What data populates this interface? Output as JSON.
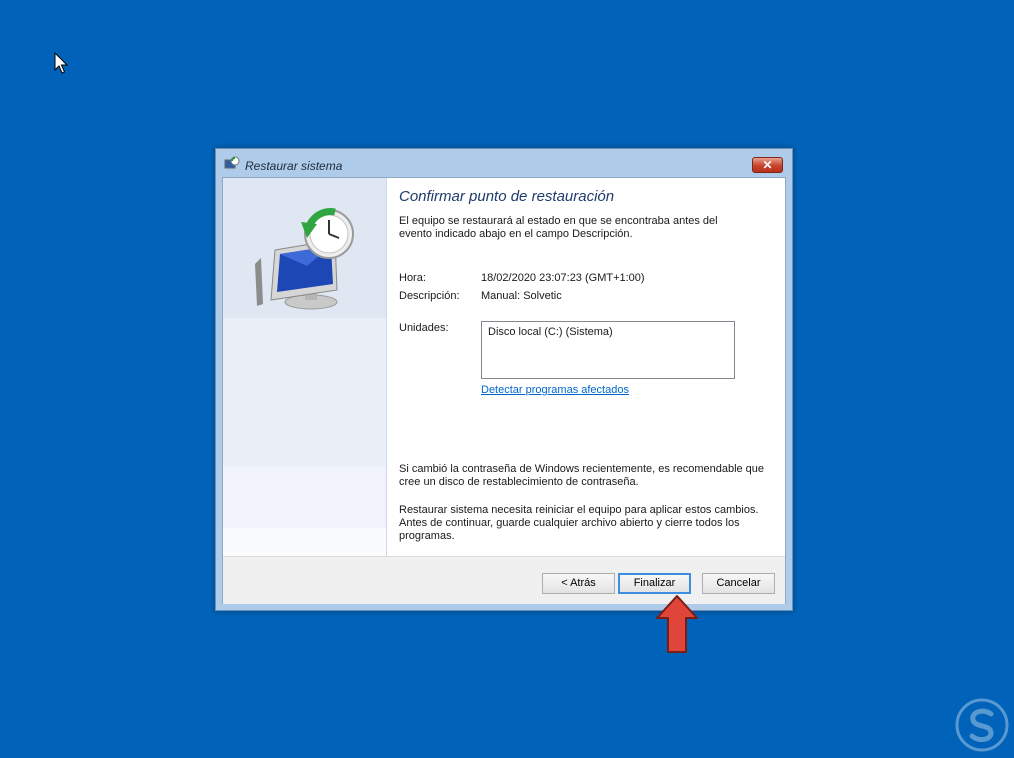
{
  "window": {
    "title": "Restaurar sistema",
    "close_label": "✕"
  },
  "page": {
    "heading": "Confirmar punto de restauración",
    "intro": "El equipo se restaurará al estado en que se encontraba antes del evento indicado abajo en el campo Descripción.",
    "time_label": "Hora:",
    "time_value": "18/02/2020 23:07:23 (GMT+1:00)",
    "description_label": "Descripción:",
    "description_value": "Manual: Solvetic",
    "drives_label": "Unidades:",
    "drives_value": "Disco local (C:) (Sistema)",
    "detect_link": "Detectar programas afectados",
    "password_note": "Si cambió la contraseña de Windows recientemente, es recomendable que cree un disco de restablecimiento de contraseña.",
    "restart_note": "Restaurar sistema necesita reiniciar el equipo para aplicar estos cambios. Antes de continuar, guarde cualquier archivo abierto y cierre todos los programas."
  },
  "buttons": {
    "back": "< Atrás",
    "finish": "Finalizar",
    "cancel": "Cancelar"
  },
  "icons": {
    "cursor": "mouse-pointer-icon",
    "title": "system-restore-icon",
    "sidebar": "restore-computer-clock-illustration",
    "annotation": "red-arrow-up-icon",
    "watermark": "solvetic-logo"
  },
  "colors": {
    "desktop": "#0063b9",
    "arrow": "#e0453a",
    "link": "#0066cc",
    "heading": "#1f3b6b"
  }
}
